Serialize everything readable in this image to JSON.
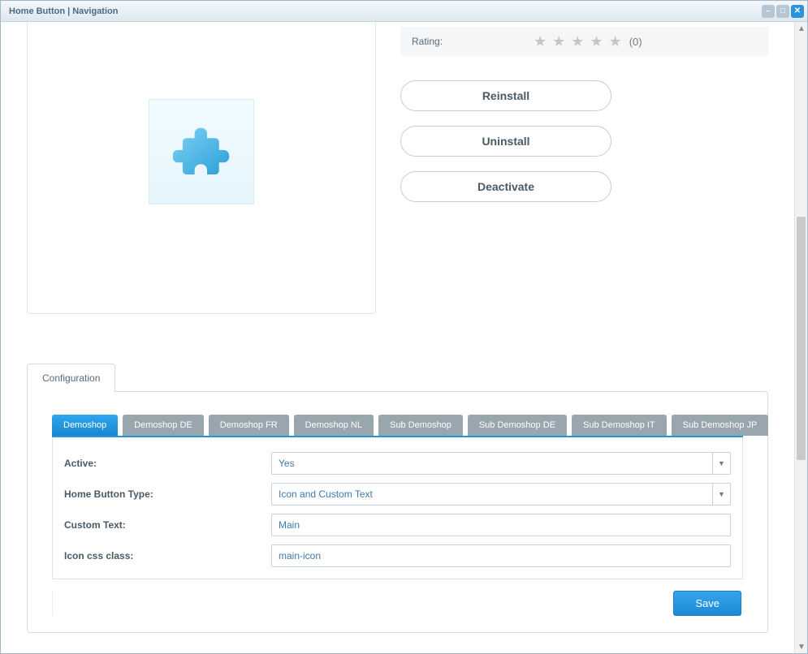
{
  "window": {
    "title": "Home Button | Navigation"
  },
  "rating": {
    "label": "Rating:",
    "count": "(0)"
  },
  "actions": {
    "reinstall": "Reinstall",
    "uninstall": "Uninstall",
    "deactivate": "Deactivate"
  },
  "config": {
    "tab_label": "Configuration",
    "subtabs": [
      "Demoshop",
      "Demoshop DE",
      "Demoshop FR",
      "Demoshop NL",
      "Sub Demoshop",
      "Sub Demoshop DE",
      "Sub Demoshop IT",
      "Sub Demoshop JP"
    ],
    "fields": {
      "active": {
        "label": "Active:",
        "value": "Yes"
      },
      "type": {
        "label": "Home Button Type:",
        "value": "Icon and Custom Text"
      },
      "custom_text": {
        "label": "Custom Text:",
        "value": "Main"
      },
      "icon_class": {
        "label": "Icon css class:",
        "value": "main-icon"
      }
    },
    "save": "Save"
  }
}
